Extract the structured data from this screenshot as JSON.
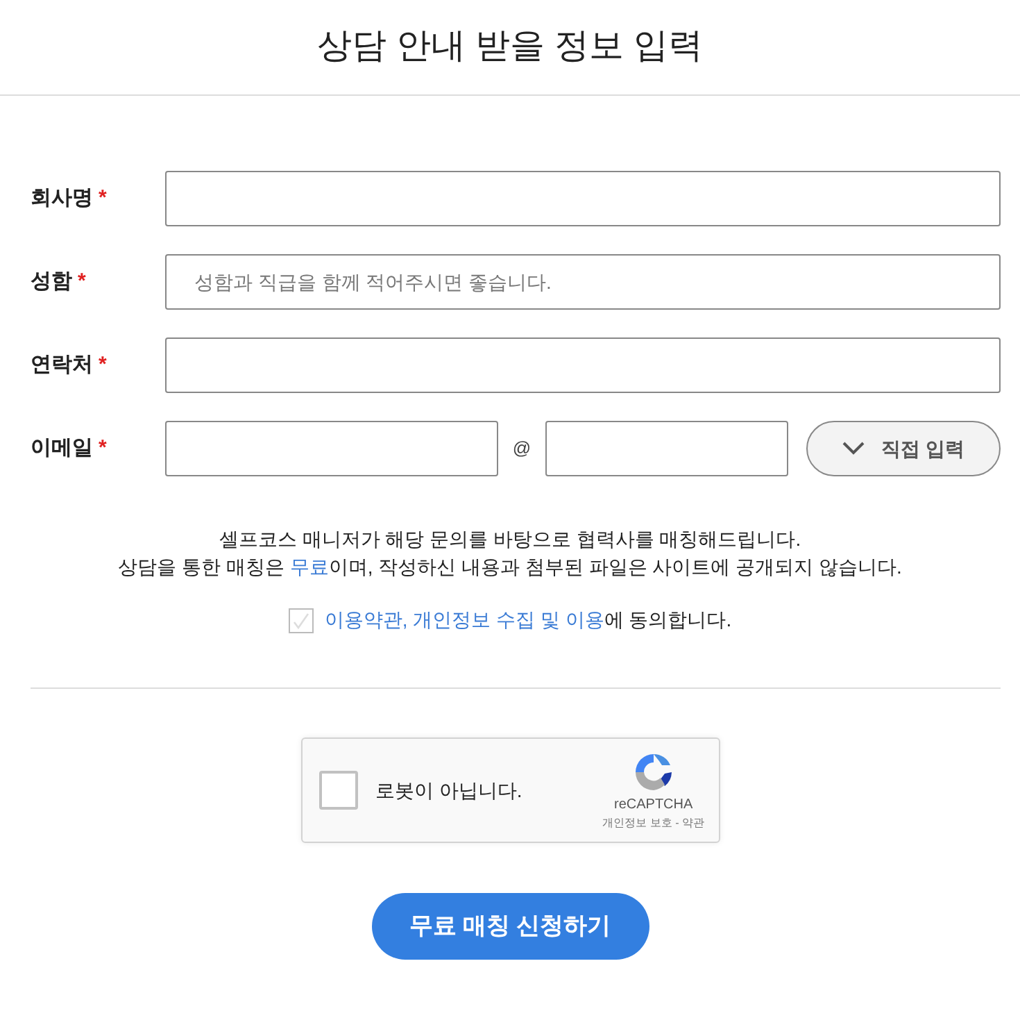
{
  "title": "상담 안내 받을 정보 입력",
  "fields": [
    {
      "kind": "text",
      "label": "회사명",
      "required_mark": "*"
    },
    {
      "kind": "text",
      "label": "성함",
      "required_mark": "*",
      "placeholder": "성함과 직급을 함께 적어주시면 좋습니다."
    },
    {
      "kind": "text",
      "label": "연락처",
      "required_mark": "*"
    },
    {
      "kind": "email",
      "label": "이메일",
      "required_mark": "*",
      "at_sign": "@",
      "domain_button": "직접 입력"
    }
  ],
  "notice": [
    [
      {
        "text": "셀프코스 매니저가 해당 문의를 바탕으로 협력사를 매칭해드립니다.",
        "highlight": false
      }
    ],
    [
      {
        "text": "상담을 통한 매칭은 ",
        "highlight": false
      },
      {
        "text": "무료",
        "highlight": true
      },
      {
        "text": "이며, 작성하신 내용과 첨부된 파일은 사이트에 공개되지 않습니다.",
        "highlight": false
      }
    ]
  ],
  "agreement": {
    "checked": false,
    "parts": [
      {
        "kind": "link",
        "text": "이용약관, "
      },
      {
        "kind": "link",
        "text": "개인정보 수집 및 이용"
      },
      {
        "kind": "plain",
        "text": "에 동의합니다."
      }
    ]
  },
  "captcha": {
    "checked": false,
    "label": "로봇이 아닙니다.",
    "brand": "reCAPTCHA",
    "links": "개인정보 보호 - 약관"
  },
  "submit": "무료 매칭 신청하기"
}
